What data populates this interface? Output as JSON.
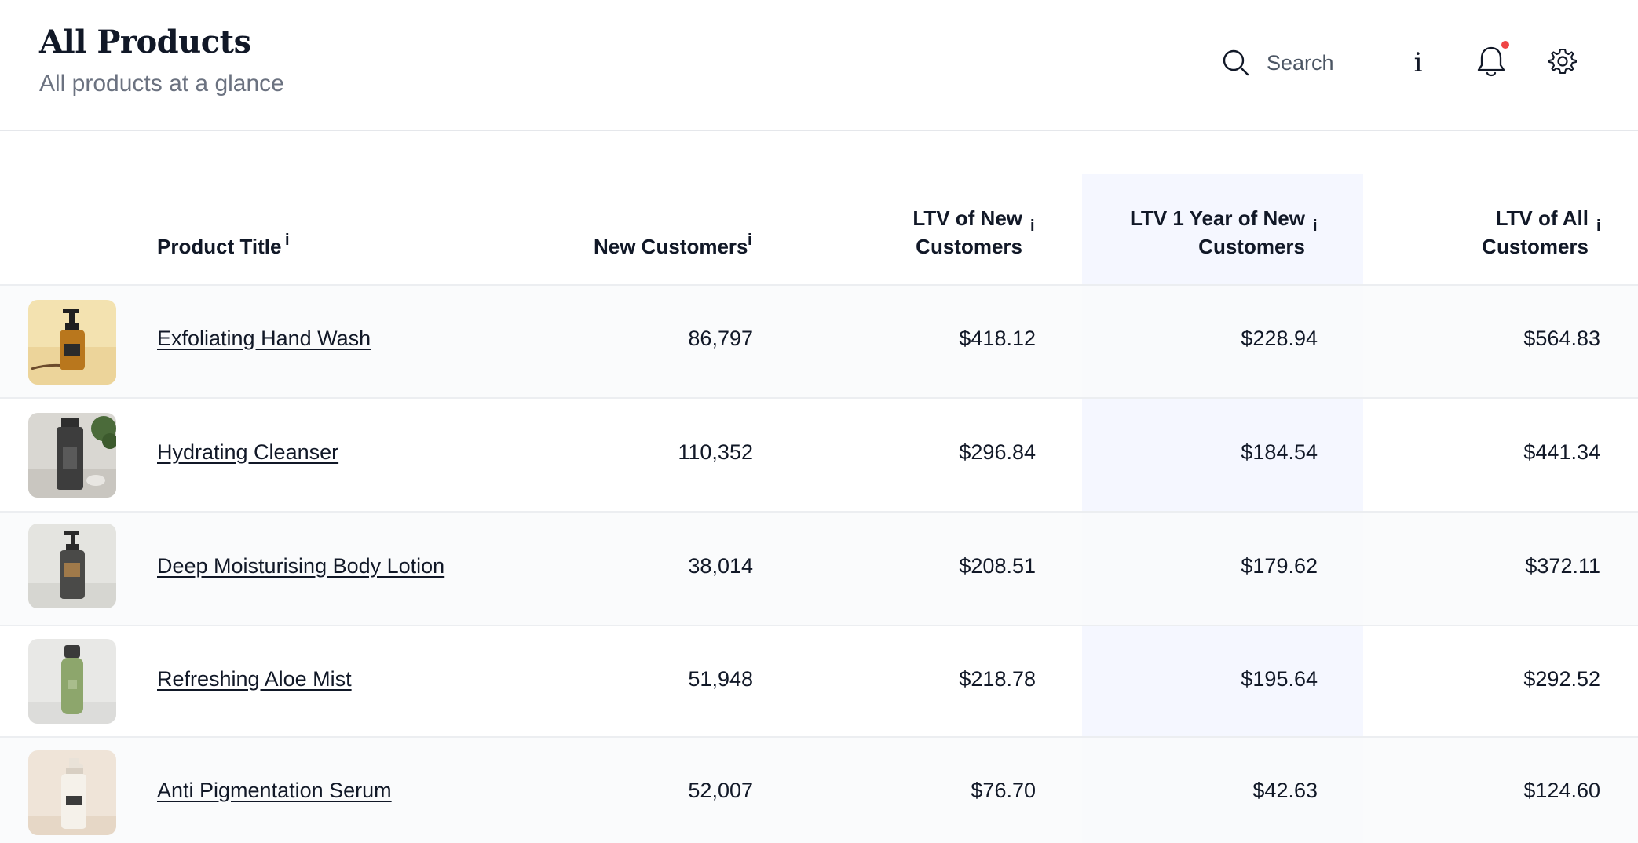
{
  "header": {
    "title": "All Products",
    "subtitle": "All products at a glance",
    "search_placeholder": "Search",
    "info_glyph": "i",
    "icons": [
      "search-icon",
      "info-icon",
      "bell-icon",
      "gear-icon"
    ],
    "notification_dot_color": "#ef4444"
  },
  "table": {
    "columns": [
      {
        "key": "title",
        "label": "Product Title",
        "info": "i"
      },
      {
        "key": "new_customers",
        "label": "New Customers",
        "info": "i"
      },
      {
        "key": "ltv_new",
        "label_line1": "LTV of New",
        "label_line2": "Customers",
        "info": "i"
      },
      {
        "key": "ltv_1yr_new",
        "label_line1": "LTV 1 Year of New",
        "label_line2": "Customers",
        "info": "i"
      },
      {
        "key": "ltv_all",
        "label_line1": "LTV of All",
        "label_line2": "Customers",
        "info": "i"
      }
    ],
    "highlight_color": "#f5f7ff",
    "rows": [
      {
        "title": "Exfoliating Hand Wash",
        "new_customers": "86,797",
        "ltv_new": "$418.12",
        "ltv_1yr_new": "$228.94",
        "ltv_all": "$564.83",
        "image": "amber-pump-bottle"
      },
      {
        "title": "Hydrating Cleanser",
        "new_customers": "110,352",
        "ltv_new": "$296.84",
        "ltv_1yr_new": "$184.54",
        "ltv_all": "$441.34",
        "image": "dark-grey-bottle"
      },
      {
        "title": "Deep Moisturising Body Lotion",
        "new_customers": "38,014",
        "ltv_new": "$208.51",
        "ltv_1yr_new": "$179.62",
        "ltv_all": "$372.11",
        "image": "grey-pump-bottle"
      },
      {
        "title": "Refreshing Aloe Mist",
        "new_customers": "51,948",
        "ltv_new": "$218.78",
        "ltv_1yr_new": "$195.64",
        "ltv_all": "$292.52",
        "image": "green-spray-bottle"
      },
      {
        "title": "Anti Pigmentation Serum",
        "new_customers": "52,007",
        "ltv_new": "$76.70",
        "ltv_1yr_new": "$42.63",
        "ltv_all": "$124.60",
        "image": "cream-pump-bottle"
      }
    ]
  }
}
